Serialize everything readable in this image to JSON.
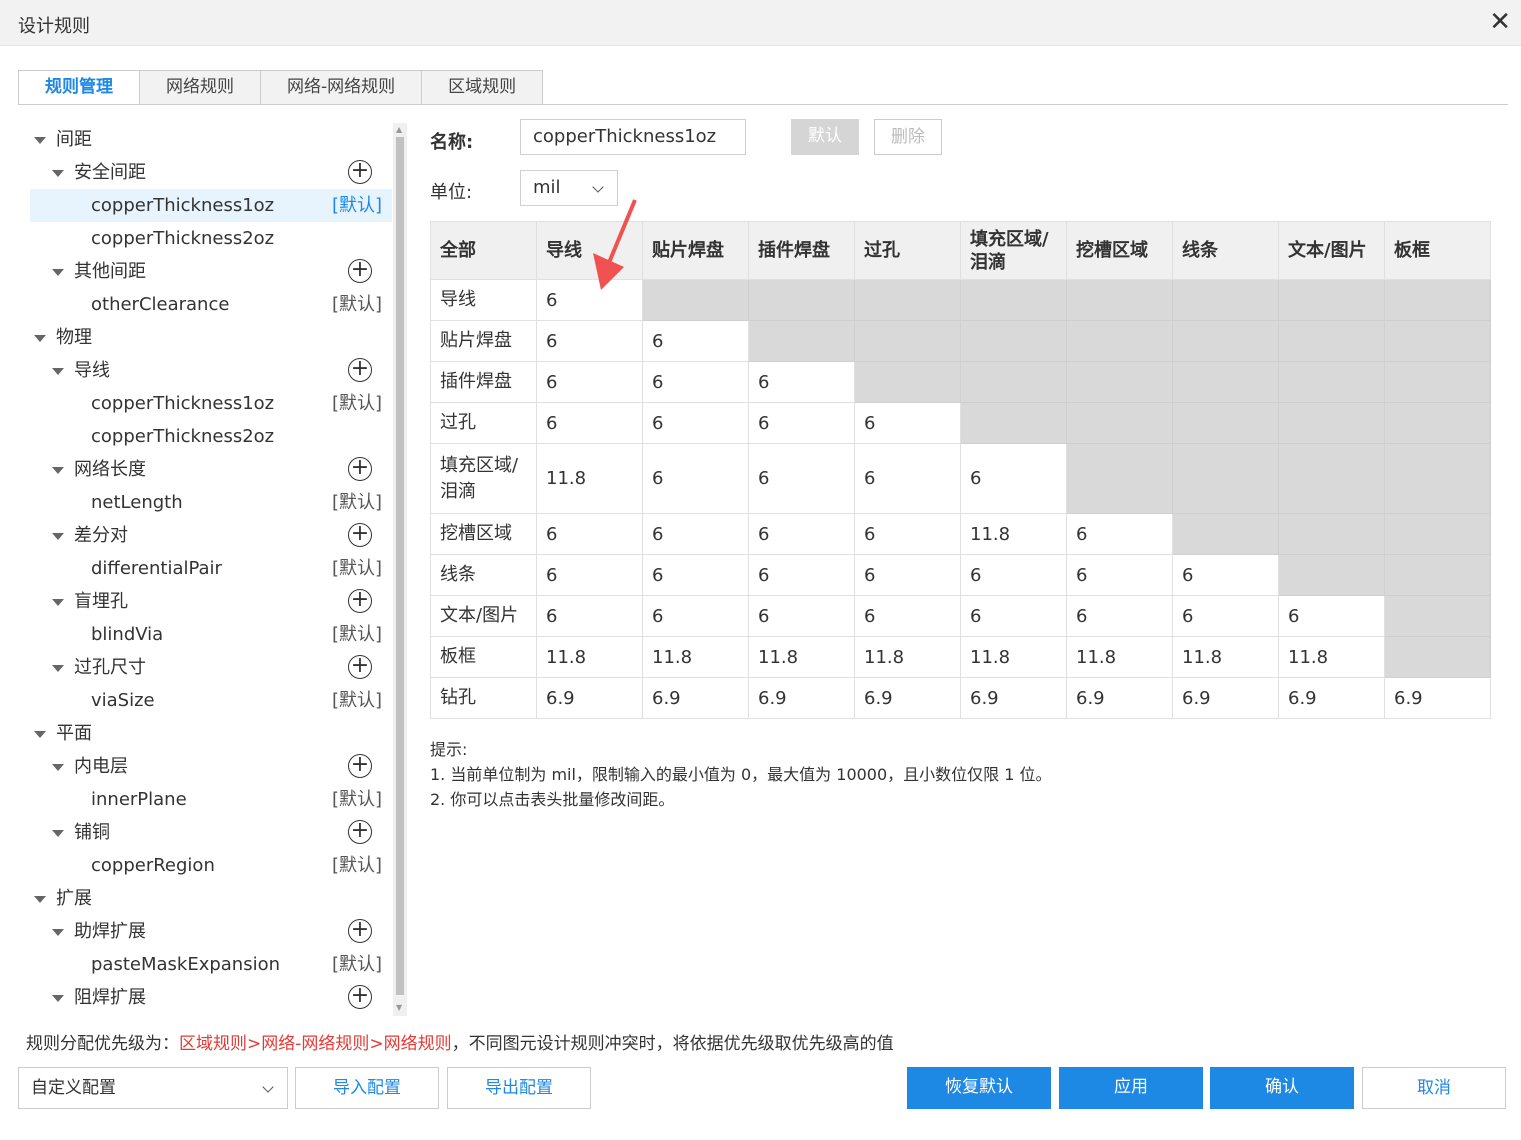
{
  "window": {
    "title": "设计规则",
    "close": "✕"
  },
  "tabs": [
    "规则管理",
    "网络规则",
    "网络-网络规则",
    "区域规则"
  ],
  "tree": [
    {
      "label": "间距",
      "level": 0
    },
    {
      "label": "安全间距",
      "level": 1,
      "add": true
    },
    {
      "label": "copperThickness1oz",
      "level": 2,
      "tag": "[默认]",
      "selected": true
    },
    {
      "label": "copperThickness2oz",
      "level": 2
    },
    {
      "label": "其他间距",
      "level": 1,
      "add": true
    },
    {
      "label": "otherClearance",
      "level": 2,
      "tag": "[默认]"
    },
    {
      "label": "物理",
      "level": 0
    },
    {
      "label": "导线",
      "level": 1,
      "add": true
    },
    {
      "label": "copperThickness1oz",
      "level": 2,
      "tag": "[默认]"
    },
    {
      "label": "copperThickness2oz",
      "level": 2
    },
    {
      "label": "网络长度",
      "level": 1,
      "add": true
    },
    {
      "label": "netLength",
      "level": 2,
      "tag": "[默认]"
    },
    {
      "label": "差分对",
      "level": 1,
      "add": true
    },
    {
      "label": "differentialPair",
      "level": 2,
      "tag": "[默认]"
    },
    {
      "label": "盲埋孔",
      "level": 1,
      "add": true
    },
    {
      "label": "blindVia",
      "level": 2,
      "tag": "[默认]"
    },
    {
      "label": "过孔尺寸",
      "level": 1,
      "add": true
    },
    {
      "label": "viaSize",
      "level": 2,
      "tag": "[默认]"
    },
    {
      "label": "平面",
      "level": 0
    },
    {
      "label": "内电层",
      "level": 1,
      "add": true
    },
    {
      "label": "innerPlane",
      "level": 2,
      "tag": "[默认]"
    },
    {
      "label": "铺铜",
      "level": 1,
      "add": true
    },
    {
      "label": "copperRegion",
      "level": 2,
      "tag": "[默认]"
    },
    {
      "label": "扩展",
      "level": 0
    },
    {
      "label": "助焊扩展",
      "level": 1,
      "add": true
    },
    {
      "label": "pasteMaskExpansion",
      "level": 2,
      "tag": "[默认]"
    },
    {
      "label": "阻焊扩展",
      "level": 1,
      "add": true
    }
  ],
  "form": {
    "name_label": "名称:",
    "name_value": "copperThickness1oz",
    "default_btn": "默认",
    "delete_btn": "删除",
    "unit_label": "单位:",
    "unit_value": "mil"
  },
  "table": {
    "columns": [
      "全部",
      "导线",
      "贴片焊盘",
      "插件焊盘",
      "过孔",
      "填充区域/\n泪滴",
      "挖槽区域",
      "线条",
      "文本/图片",
      "板框"
    ],
    "rows": [
      {
        "label": "导线",
        "values": [
          "6"
        ]
      },
      {
        "label": "贴片焊盘",
        "values": [
          "6",
          "6"
        ]
      },
      {
        "label": "插件焊盘",
        "values": [
          "6",
          "6",
          "6"
        ]
      },
      {
        "label": "过孔",
        "values": [
          "6",
          "6",
          "6",
          "6"
        ]
      },
      {
        "label": "填充区域/\n泪滴",
        "values": [
          "11.8",
          "6",
          "6",
          "6",
          "6"
        ]
      },
      {
        "label": "挖槽区域",
        "values": [
          "6",
          "6",
          "6",
          "6",
          "11.8",
          "6"
        ]
      },
      {
        "label": "线条",
        "values": [
          "6",
          "6",
          "6",
          "6",
          "6",
          "6",
          "6"
        ]
      },
      {
        "label": "文本/图片",
        "values": [
          "6",
          "6",
          "6",
          "6",
          "6",
          "6",
          "6",
          "6"
        ]
      },
      {
        "label": "板框",
        "values": [
          "11.8",
          "11.8",
          "11.8",
          "11.8",
          "11.8",
          "11.8",
          "11.8",
          "11.8"
        ]
      },
      {
        "label": "钻孔",
        "values": [
          "6.9",
          "6.9",
          "6.9",
          "6.9",
          "6.9",
          "6.9",
          "6.9",
          "6.9",
          "6.9"
        ]
      }
    ]
  },
  "hint": {
    "title": "提示:",
    "line1": "1. 当前单位制为 mil，限制输入的最小值为 0，最大值为 10000，且小数位仅限 1 位。",
    "line2": "2. 你可以点击表头批量修改间距。"
  },
  "priority": {
    "prefix": "规则分配优先级为：",
    "order": "区域规则>网络-网络规则>网络规则",
    "suffix": "，不同图元设计规则冲突时，将依据优先级取优先级高的值"
  },
  "bottom": {
    "config_select": "自定义配置",
    "import": "导入配置",
    "export": "导出配置",
    "restore": "恢复默认",
    "apply": "应用",
    "confirm": "确认",
    "cancel": "取消"
  },
  "colors": {
    "accent": "#1e88e5",
    "priority_red": "#e53935",
    "arrow": "#f05252"
  }
}
